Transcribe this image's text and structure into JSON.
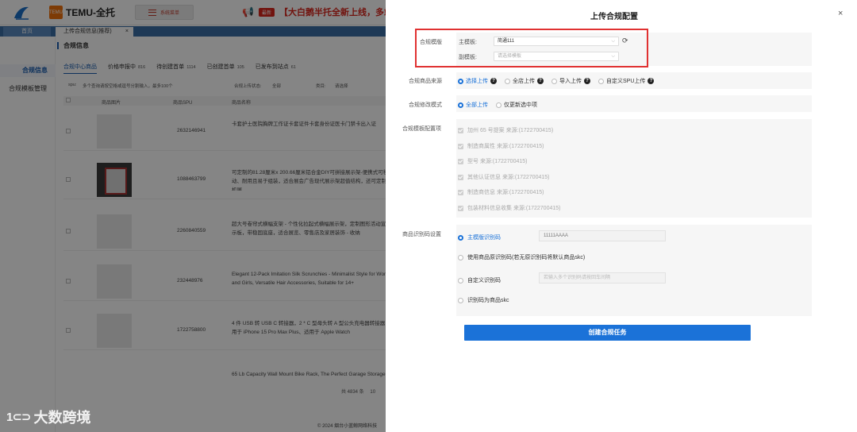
{
  "app": {
    "brand": "TEMU-全托",
    "brand_box": "TEMU",
    "system_menu": "系统菜单",
    "announce_tag": "最新",
    "announcement": "【大白鹅半托全新上线，多站"
  },
  "tabs": {
    "home": "首页",
    "active": "上传合规信息(推荐)",
    "close": "×"
  },
  "sidebar": {
    "items": [
      "合规信息",
      "合规模板管理"
    ]
  },
  "main": {
    "title": "合规信息",
    "subtabs": [
      {
        "label": "合规中心商品",
        "count": ""
      },
      {
        "label": "价格申报中",
        "count": "816"
      },
      {
        "label": "待创建首单",
        "count": "1114"
      },
      {
        "label": "已创建首单",
        "count": "105"
      },
      {
        "label": "已发布到站点",
        "count": "61"
      }
    ],
    "filters": {
      "spu_label": "spu:",
      "spu_placeholder": "多个查询请按空格或逗号分割输入，最多100个",
      "status_label": "合规上传状态:",
      "status_value": "全部",
      "category_label": "类目:",
      "category_placeholder": "请选择"
    },
    "columns": [
      "商品图片",
      "商品SPU",
      "商品名称"
    ],
    "rows": [
      {
        "spu": "2632146941",
        "name": "卡套护士医院胸牌工作证卡套证件卡套身份证医卡门禁卡出入证"
      },
      {
        "spu": "1088463799",
        "name": "可定制的81.28厘米x 200.66厘米铝合金DIY可拼接展示架-便携式可移动、耐用且易于组装，适合展会广告现代展示架超值结构，还可定制色颜机展"
      },
      {
        "spu": "2260840559",
        "name": "超大号卷帘式横幅支架 - 个性化拉起式横幅展示架，定制图形活动宣传展示板，带稳固底座，适合展览、零售店及家居装饰 - 收纳"
      },
      {
        "spu": "232448976",
        "name": "Elegant 12-Pack Imitation Silk Scrunchies - Minimalist Style for Women and Girls, Versatile Hair Accessories, Suitable for 14+"
      },
      {
        "spu": "1722758800",
        "name": "4 件 USB 转 USB C 转接器，2 * C 型母头转 A 型公头充电器转接器，适用于 iPhone 15 Pro Max Plus、适用于 Apple Watch"
      },
      {
        "spu": "",
        "name": "65 Lb Capacity Wall Mount Bike Rack, The Perfect Garage Storage"
      }
    ],
    "pager": "共 4834 条",
    "pager_size": "10",
    "footer": "© 2024 烟台小蓝鲸网络科技"
  },
  "watermark": {
    "logo": "1⊂⊃",
    "text": "大数跨境"
  },
  "drawer": {
    "title": "上传合规配置",
    "close": "×",
    "template": {
      "label": "合规模版",
      "main_label": "主模板:",
      "main_value": "简通111",
      "sub_label": "副模板:",
      "sub_placeholder": "请选择模板"
    },
    "source": {
      "label": "合规商品来源",
      "options": [
        {
          "label": "选择上传",
          "selected": true,
          "help": "?"
        },
        {
          "label": "全店上传",
          "selected": false,
          "help": "?"
        },
        {
          "label": "导入上传",
          "selected": false,
          "help": "?"
        },
        {
          "label": "自定义SPU上传",
          "selected": false,
          "help": "?"
        }
      ]
    },
    "mode": {
      "label": "合规修改模式",
      "options": [
        {
          "label": "全部上传",
          "selected": true
        },
        {
          "label": "仅更新选中项",
          "selected": false
        }
      ]
    },
    "config": {
      "label": "合规模板配置项",
      "items": [
        "加州 65 号提案 来源:(1722700415)",
        "制造商属性 来源:(1722700415)",
        "型号 来源:(1722700415)",
        "其他认证信息 来源:(1722700415)",
        "制造商信息 来源:(1722700415)",
        "包装材料信息收集 来源:(1722700415)"
      ]
    },
    "identifier": {
      "label": "商品识别码设置",
      "opt1": "主模版识别码",
      "opt1_value": "11111AAAA",
      "opt2": "使用商品原识别码(若无原识别码将默认商品skc)",
      "opt3": "自定义识别码",
      "opt3_placeholder": "若输入多个识别码请按回车间隔",
      "opt4": "识别码为商品skc"
    },
    "create_button": "创建合规任务"
  },
  "colors": {
    "accent": "#1b72d8",
    "highlight_box": "#e03131",
    "tab_bar": "#3a6ea5"
  }
}
